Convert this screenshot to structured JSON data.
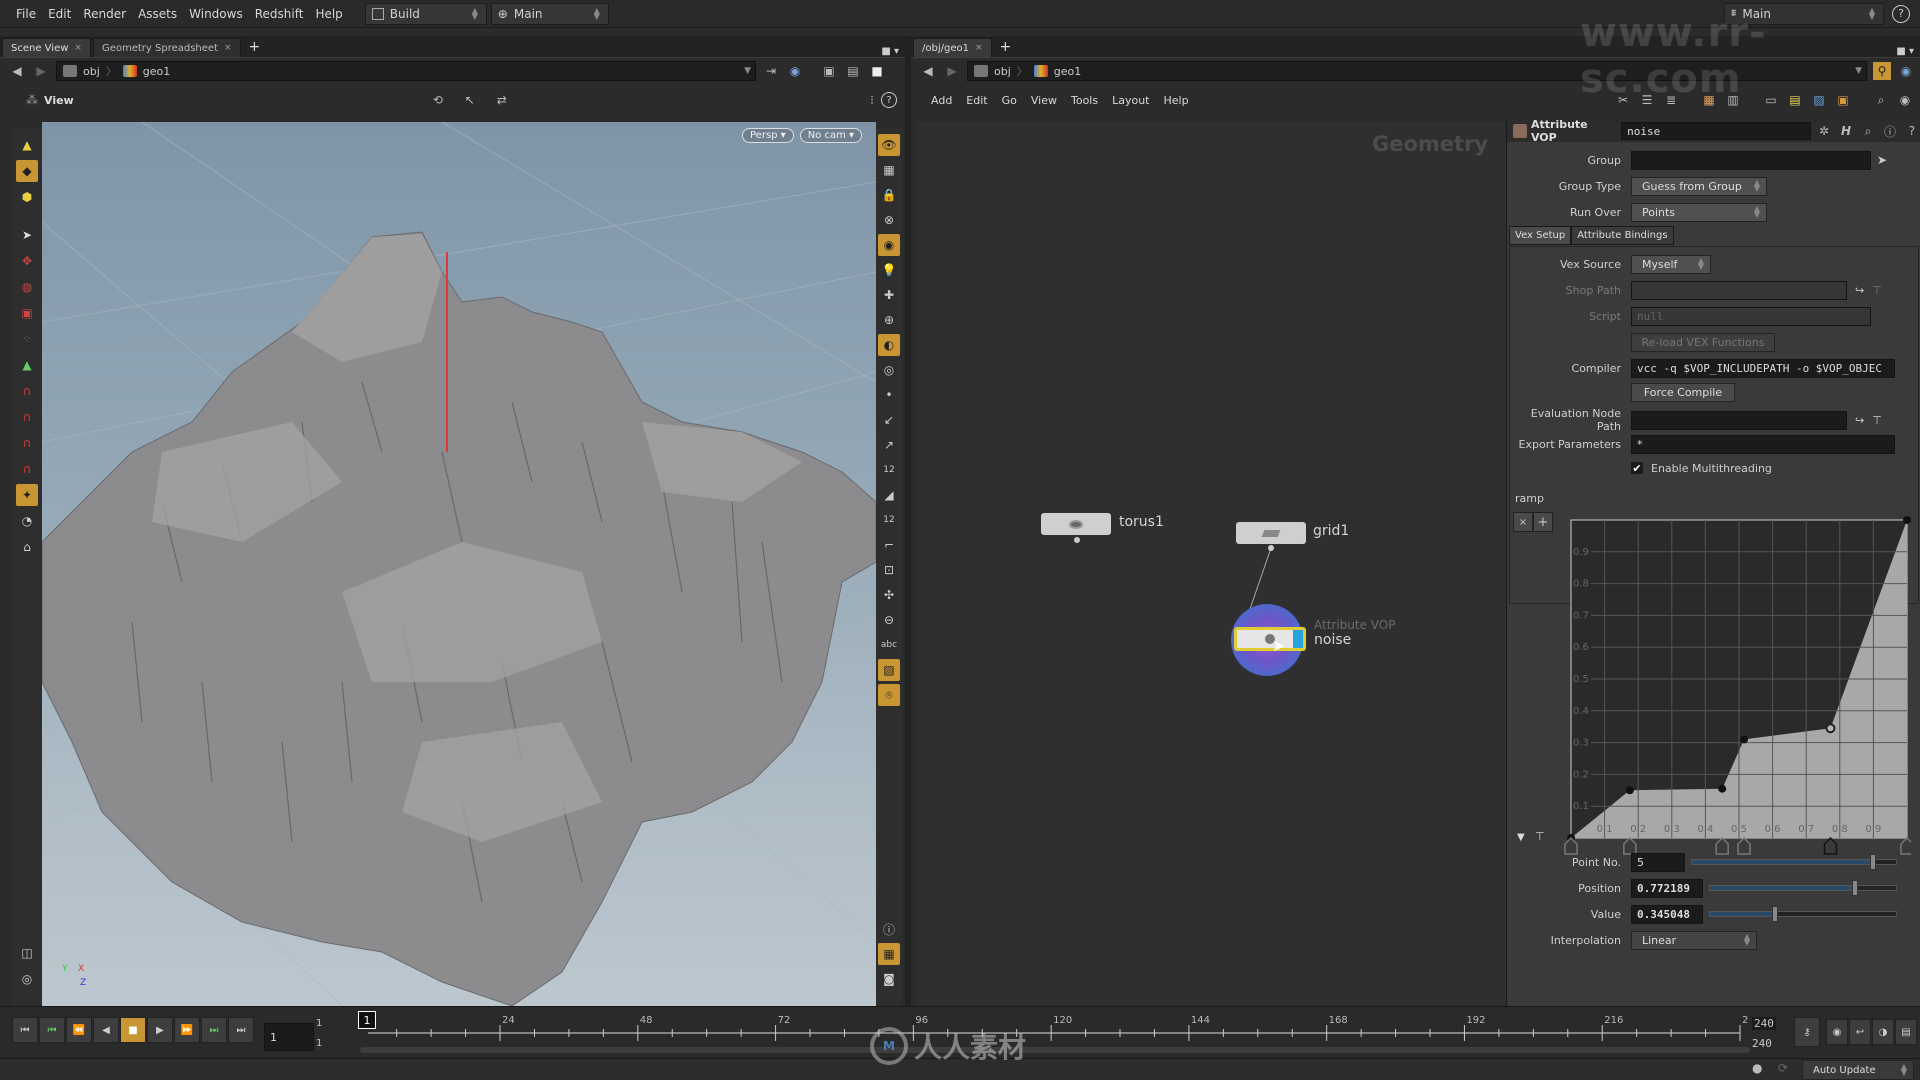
{
  "menubar": {
    "items": [
      "File",
      "Edit",
      "Render",
      "Assets",
      "Windows",
      "Redshift",
      "Help"
    ],
    "desktop": "Build",
    "context": "Main",
    "right_context": "Main",
    "help_icon": "question-icon"
  },
  "left_pane": {
    "tabs": [
      {
        "label": "Scene View",
        "active": true
      },
      {
        "label": "Geometry Spreadsheet",
        "active": false
      }
    ],
    "path": [
      "obj",
      "geo1"
    ],
    "view_label": "View",
    "camera_persp": "Persp",
    "camera_cam": "No cam",
    "axis": {
      "x": "X",
      "y": "Y",
      "z": "Z"
    }
  },
  "right_pane": {
    "tabs": [
      {
        "label": "/obj/geo1",
        "active": true
      }
    ],
    "path": [
      "obj",
      "geo1"
    ],
    "menu": [
      "Add",
      "Edit",
      "Go",
      "View",
      "Tools",
      "Layout",
      "Help"
    ],
    "context_watermark": "Geometry"
  },
  "network": {
    "nodes": [
      {
        "name": "torus1",
        "type": "torus"
      },
      {
        "name": "grid1",
        "type": "grid"
      },
      {
        "name": "noise",
        "type": "Attribute VOP",
        "selected": true
      }
    ]
  },
  "params": {
    "node_type": "Attribute VOP",
    "node_name": "noise",
    "group_label": "Group",
    "group_value": "",
    "group_type_label": "Group Type",
    "group_type_value": "Guess from Group",
    "run_over_label": "Run Over",
    "run_over_value": "Points",
    "tabs": [
      {
        "label": "Vex Setup",
        "active": true
      },
      {
        "label": "Attribute Bindings",
        "active": false
      }
    ],
    "vex_source_label": "Vex Source",
    "vex_source_value": "Myself",
    "shop_path_label": "Shop Path",
    "shop_path_value": "",
    "script_label": "Script",
    "script_value": "null",
    "reload_label": "Re-load VEX Functions",
    "compiler_label": "Compiler",
    "compiler_value": "vcc -q $VOP_INCLUDEPATH -o $VOP_OBJEC",
    "force_compile_label": "Force Compile",
    "eval_path_label": "Evaluation Node Path",
    "eval_path_value": "",
    "export_params_label": "Export Parameters",
    "export_params_value": "*",
    "multithreading_label": "Enable Multithreading",
    "multithreading_checked": true,
    "ramp": {
      "label": "ramp",
      "x_ticks": [
        "0.1",
        "0.2",
        "0.3",
        "0.4",
        "0.5",
        "0.6",
        "0.7",
        "0.8",
        "0.9"
      ],
      "y_ticks": [
        "0.1",
        "0.2",
        "0.3",
        "0.4",
        "0.5",
        "0.6",
        "0.7",
        "0.8",
        "0.9"
      ],
      "points": [
        {
          "pos": 0.0,
          "value": 0.0
        },
        {
          "pos": 0.175,
          "value": 0.15
        },
        {
          "pos": 0.45,
          "value": 0.155
        },
        {
          "pos": 0.515,
          "value": 0.31
        },
        {
          "pos": 0.772189,
          "value": 0.345048
        },
        {
          "pos": 1.0,
          "value": 1.0
        }
      ],
      "selected_index": 4
    },
    "point_no_label": "Point No.",
    "point_no_value": "5",
    "point_no_slider": 0.88,
    "position_label": "Position",
    "position_value": "0.772189",
    "value_label": "Value",
    "value_value": "0.345048",
    "interpolation_label": "Interpolation",
    "interpolation_value": "Linear"
  },
  "timeline": {
    "current_frame": "1",
    "start": "1",
    "start2": "1",
    "end": "240",
    "end2": "240",
    "frame_field": "1",
    "ticks": [
      "24",
      "48",
      "72",
      "96",
      "120",
      "144",
      "168",
      "192",
      "216",
      "2"
    ],
    "range": [
      1,
      240
    ]
  },
  "status": {
    "auto_update": "Auto Update"
  },
  "watermark": {
    "site": "www.rr-sc.com",
    "logo_text": "人人素材"
  }
}
